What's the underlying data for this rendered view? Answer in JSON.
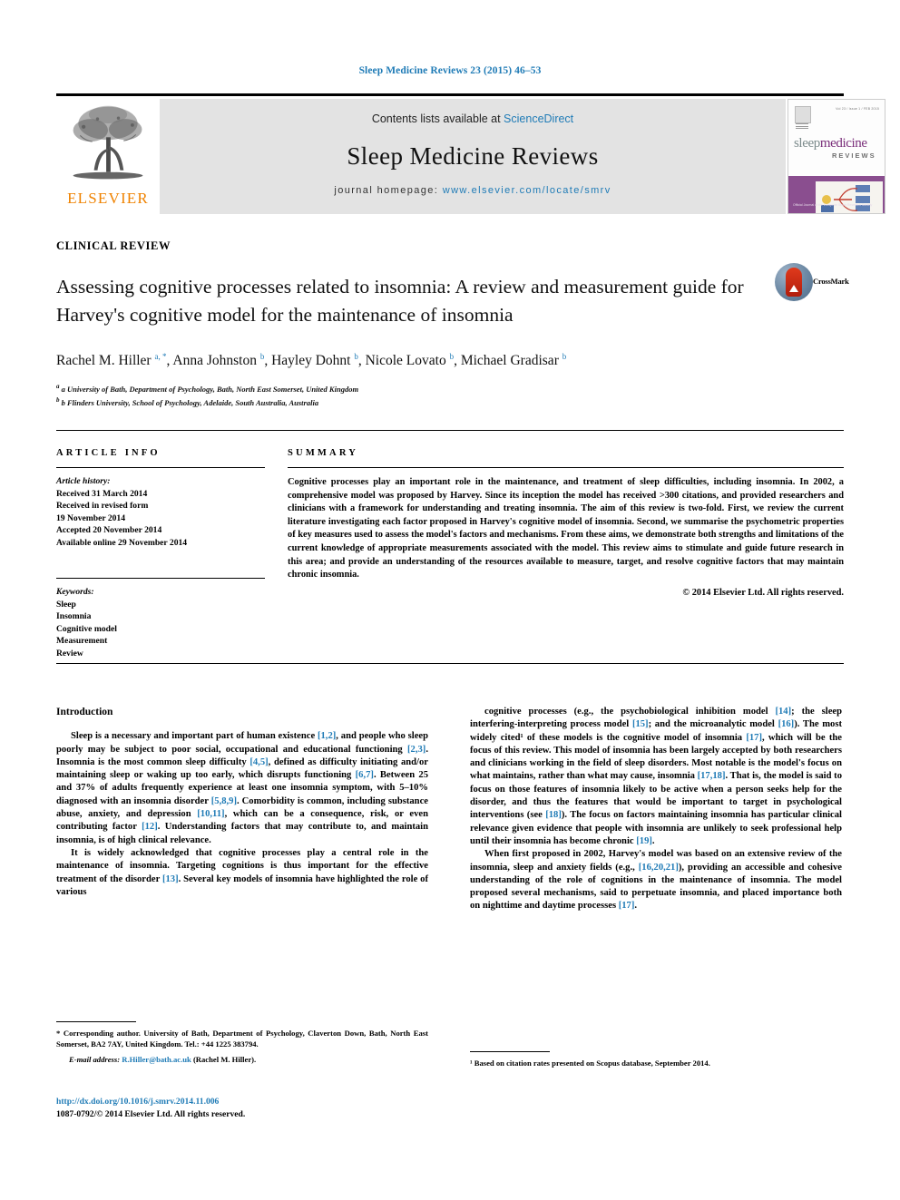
{
  "running_head": "Sleep Medicine Reviews 23 (2015) 46–53",
  "masthead": {
    "contents_prefix": "Contents lists available at ",
    "contents_link": "ScienceDirect",
    "journal_title": "Sleep Medicine Reviews",
    "homepage_prefix": "journal homepage: ",
    "homepage_link": "www.elsevier.com/locate/smrv",
    "publisher": "ELSEVIER",
    "cover": {
      "name_part1": "sleep",
      "name_part2": "medicine",
      "subtitle": "REVIEWS",
      "issue_text": "Vol 23 / Issue 1 / FEB 2015",
      "fineprint": "Official Journal of the\nEuropean Sleep\nResearch Society"
    },
    "accent_link_color": "#1f7bb6",
    "publisher_color": "#ef8200"
  },
  "article_type": "CLINICAL REVIEW",
  "title": "Assessing cognitive processes related to insomnia: A review and measurement guide for Harvey's cognitive model for the maintenance of insomnia",
  "crossmark_label": "CrossMark",
  "authors_html": "Rachel M. Hiller <sup>a, *</sup>, Anna Johnston <sup>b</sup>, Hayley Dohnt <sup>b</sup>, Nicole Lovato <sup>b</sup>, Michael Gradisar <sup>b</sup>",
  "affiliations": [
    "a University of Bath, Department of Psychology, Bath, North East Somerset, United Kingdom",
    "b Flinders University, School of Psychology, Adelaide, South Australia, Australia"
  ],
  "article_info": {
    "heading": "ARTICLE INFO",
    "history_label": "Article history:",
    "history": [
      "Received 31 March 2014",
      "Received in revised form",
      "19 November 2014",
      "Accepted 20 November 2014",
      "Available online 29 November 2014"
    ],
    "keywords_label": "Keywords:",
    "keywords": [
      "Sleep",
      "Insomnia",
      "Cognitive model",
      "Measurement",
      "Review"
    ]
  },
  "summary": {
    "heading": "SUMMARY",
    "text": "Cognitive processes play an important role in the maintenance, and treatment of sleep difficulties, including insomnia. In 2002, a comprehensive model was proposed by Harvey. Since its inception the model has received >300 citations, and provided researchers and clinicians with a framework for understanding and treating insomnia. The aim of this review is two-fold. First, we review the current literature investigating each factor proposed in Harvey's cognitive model of insomnia. Second, we summarise the psychometric properties of key measures used to assess the model's factors and mechanisms. From these aims, we demonstrate both strengths and limitations of the current knowledge of appropriate measurements associated with the model. This review aims to stimulate and guide future research in this area; and provide an understanding of the resources available to measure, target, and resolve cognitive factors that may maintain chronic insomnia.",
    "copyright": "© 2014 Elsevier Ltd. All rights reserved."
  },
  "body": {
    "section_heading": "Introduction",
    "left_paragraphs": [
      "Sleep is a necessary and important part of human existence [1,2], and people who sleep poorly may be subject to poor social, occupational and educational functioning [2,3]. Insomnia is the most common sleep difficulty [4,5], defined as difficulty initiating and/or maintaining sleep or waking up too early, which disrupts functioning [6,7]. Between 25 and 37% of adults frequently experience at least one insomnia symptom, with 5–10% diagnosed with an insomnia disorder [5,8,9]. Comorbidity is common, including substance abuse, anxiety, and depression [10,11], which can be a consequence, risk, or even contributing factor [12]. Understanding factors that may contribute to, and maintain insomnia, is of high clinical relevance.",
      "It is widely acknowledged that cognitive processes play a central role in the maintenance of insomnia. Targeting cognitions is thus important for the effective treatment of the disorder [13]. Several key models of insomnia have highlighted the role of various"
    ],
    "right_paragraphs": [
      "cognitive processes (e.g., the psychobiological inhibition model [14]; the sleep interfering-interpreting process model [15]; and the microanalytic model [16]). The most widely cited¹ of these models is the cognitive model of insomnia [17], which will be the focus of this review. This model of insomnia has been largely accepted by both researchers and clinicians working in the field of sleep disorders. Most notable is the model's focus on what maintains, rather than what may cause, insomnia [17,18]. That is, the model is said to focus on those features of insomnia likely to be active when a person seeks help for the disorder, and thus the features that would be important to target in psychological interventions (see [18]). The focus on factors maintaining insomnia has particular clinical relevance given evidence that people with insomnia are unlikely to seek professional help until their insomnia has become chronic [19].",
      "When first proposed in 2002, Harvey's model was based on an extensive review of the insomnia, sleep and anxiety fields (e.g., [16,20,21]), providing an accessible and cohesive understanding of the role of cognitions in the maintenance of insomnia. The model proposed several mechanisms, said to perpetuate insomnia, and placed importance both on nighttime and daytime processes [17]."
    ]
  },
  "footnotes": {
    "corresponding": "* Corresponding author. University of Bath, Department of Psychology, Claverton Down, Bath, North East Somerset, BA2 7AY, United Kingdom. Tel.: +44 1225 383794.",
    "email_label": "E-mail address:",
    "email": "R.Hiller@bath.ac.uk",
    "email_suffix": "(Rachel M. Hiller).",
    "right_note": "¹ Based on citation rates presented on Scopus database, September 2014."
  },
  "doc_footer": {
    "doi": "http://dx.doi.org/10.1016/j.smrv.2014.11.006",
    "issn_line": "1087-0792/© 2014 Elsevier Ltd. All rights reserved."
  }
}
